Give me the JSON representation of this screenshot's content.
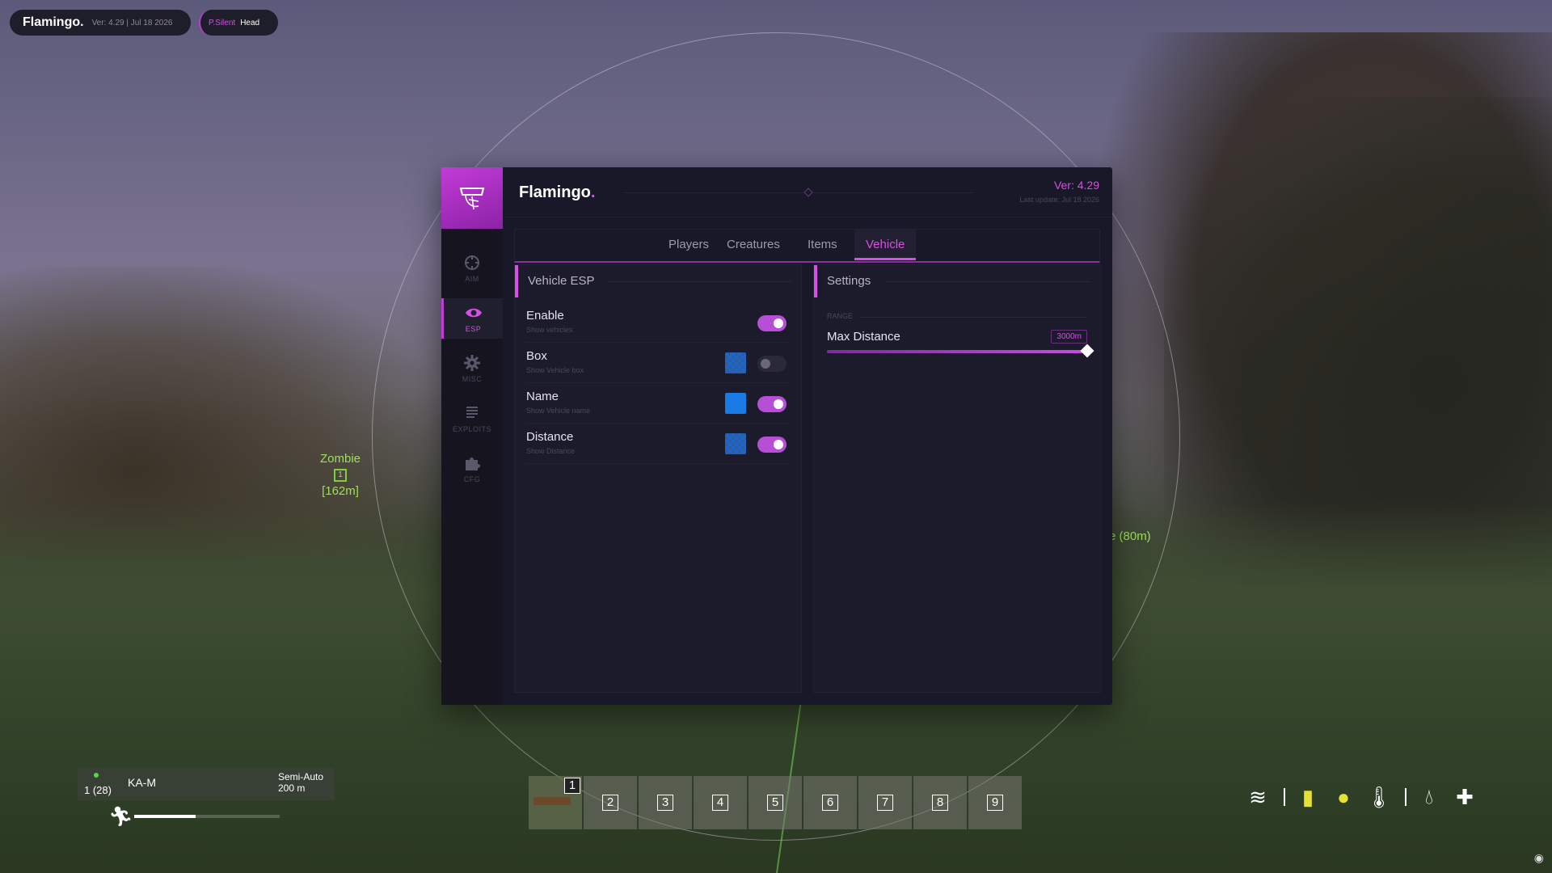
{
  "topbar": {
    "brand": "Flamingo.",
    "meta": "Ver: 4.29  |  Jul 18 2026",
    "aim_mode": "P.Silent",
    "aim_bone": "Head"
  },
  "esp_overlay": {
    "zombie_name": "Zombie",
    "zombie_box_label": "1",
    "zombie_distance": "[162m]",
    "right_label": "e (80m)"
  },
  "menu": {
    "title": "Flamingo",
    "title_dot": ".",
    "version": "Ver: 4.29",
    "last_update": "Last update: Jul 18 2026",
    "sidebar": [
      {
        "label": "AIM",
        "icon": "crosshair-icon"
      },
      {
        "label": "ESP",
        "icon": "eye-icon"
      },
      {
        "label": "MISC",
        "icon": "gear-icon"
      },
      {
        "label": "EXPLOITS",
        "icon": "list-icon"
      },
      {
        "label": "CFG",
        "icon": "puzzle-icon"
      }
    ],
    "active_sidebar": "ESP",
    "tabs": [
      "Players",
      "Creatures",
      "Items",
      "Vehicle"
    ],
    "active_tab": "Vehicle",
    "left_panel": {
      "title": "Vehicle ESP",
      "rows": [
        {
          "name": "Enable",
          "sub": "Show vehicles",
          "toggle": true,
          "has_swatch": false
        },
        {
          "name": "Box",
          "sub": "Show Vehicle box",
          "toggle": false,
          "has_swatch": true,
          "swatch": "checker"
        },
        {
          "name": "Name",
          "sub": "Show Vehicle name",
          "toggle": true,
          "has_swatch": true,
          "swatch": "solid"
        },
        {
          "name": "Distance",
          "sub": "Show Distance",
          "toggle": true,
          "has_swatch": true,
          "swatch": "checker"
        }
      ]
    },
    "right_panel": {
      "title": "Settings",
      "section": "RANGE",
      "setting_name": "Max Distance",
      "setting_value": "3000m",
      "slider_fraction": 1.0
    }
  },
  "hud": {
    "ammo": "1 (28)",
    "weapon": "KA-M",
    "fire_mode": "Semi-Auto",
    "zeroing": "200 m",
    "stamina_fraction": 0.42,
    "hotbar": [
      "1",
      "2",
      "3",
      "4",
      "5",
      "6",
      "7",
      "8",
      "9"
    ],
    "status_icons": [
      "water-level-icon",
      "water-bottle-icon",
      "food-apple-icon",
      "thermometer-icon",
      "blood-drop-icon",
      "health-cross-icon"
    ]
  },
  "colors": {
    "accent": "#d84ee6",
    "menu_bg": "#181828",
    "panel_bg": "#1c1b2b",
    "esp_green": "#9ee05a",
    "swatch_blue": "#1a7ae6"
  }
}
